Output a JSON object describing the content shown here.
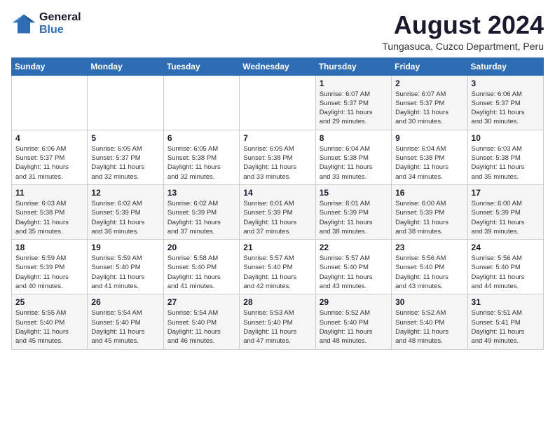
{
  "header": {
    "logo_line1": "General",
    "logo_line2": "Blue",
    "month_title": "August 2024",
    "location": "Tungasuca, Cuzco Department, Peru"
  },
  "weekdays": [
    "Sunday",
    "Monday",
    "Tuesday",
    "Wednesday",
    "Thursday",
    "Friday",
    "Saturday"
  ],
  "weeks": [
    [
      {
        "day": "",
        "info": ""
      },
      {
        "day": "",
        "info": ""
      },
      {
        "day": "",
        "info": ""
      },
      {
        "day": "",
        "info": ""
      },
      {
        "day": "1",
        "info": "Sunrise: 6:07 AM\nSunset: 5:37 PM\nDaylight: 11 hours\nand 29 minutes."
      },
      {
        "day": "2",
        "info": "Sunrise: 6:07 AM\nSunset: 5:37 PM\nDaylight: 11 hours\nand 30 minutes."
      },
      {
        "day": "3",
        "info": "Sunrise: 6:06 AM\nSunset: 5:37 PM\nDaylight: 11 hours\nand 30 minutes."
      }
    ],
    [
      {
        "day": "4",
        "info": "Sunrise: 6:06 AM\nSunset: 5:37 PM\nDaylight: 11 hours\nand 31 minutes."
      },
      {
        "day": "5",
        "info": "Sunrise: 6:05 AM\nSunset: 5:37 PM\nDaylight: 11 hours\nand 32 minutes."
      },
      {
        "day": "6",
        "info": "Sunrise: 6:05 AM\nSunset: 5:38 PM\nDaylight: 11 hours\nand 32 minutes."
      },
      {
        "day": "7",
        "info": "Sunrise: 6:05 AM\nSunset: 5:38 PM\nDaylight: 11 hours\nand 33 minutes."
      },
      {
        "day": "8",
        "info": "Sunrise: 6:04 AM\nSunset: 5:38 PM\nDaylight: 11 hours\nand 33 minutes."
      },
      {
        "day": "9",
        "info": "Sunrise: 6:04 AM\nSunset: 5:38 PM\nDaylight: 11 hours\nand 34 minutes."
      },
      {
        "day": "10",
        "info": "Sunrise: 6:03 AM\nSunset: 5:38 PM\nDaylight: 11 hours\nand 35 minutes."
      }
    ],
    [
      {
        "day": "11",
        "info": "Sunrise: 6:03 AM\nSunset: 5:38 PM\nDaylight: 11 hours\nand 35 minutes."
      },
      {
        "day": "12",
        "info": "Sunrise: 6:02 AM\nSunset: 5:39 PM\nDaylight: 11 hours\nand 36 minutes."
      },
      {
        "day": "13",
        "info": "Sunrise: 6:02 AM\nSunset: 5:39 PM\nDaylight: 11 hours\nand 37 minutes."
      },
      {
        "day": "14",
        "info": "Sunrise: 6:01 AM\nSunset: 5:39 PM\nDaylight: 11 hours\nand 37 minutes."
      },
      {
        "day": "15",
        "info": "Sunrise: 6:01 AM\nSunset: 5:39 PM\nDaylight: 11 hours\nand 38 minutes."
      },
      {
        "day": "16",
        "info": "Sunrise: 6:00 AM\nSunset: 5:39 PM\nDaylight: 11 hours\nand 38 minutes."
      },
      {
        "day": "17",
        "info": "Sunrise: 6:00 AM\nSunset: 5:39 PM\nDaylight: 11 hours\nand 39 minutes."
      }
    ],
    [
      {
        "day": "18",
        "info": "Sunrise: 5:59 AM\nSunset: 5:39 PM\nDaylight: 11 hours\nand 40 minutes."
      },
      {
        "day": "19",
        "info": "Sunrise: 5:59 AM\nSunset: 5:40 PM\nDaylight: 11 hours\nand 41 minutes."
      },
      {
        "day": "20",
        "info": "Sunrise: 5:58 AM\nSunset: 5:40 PM\nDaylight: 11 hours\nand 41 minutes."
      },
      {
        "day": "21",
        "info": "Sunrise: 5:57 AM\nSunset: 5:40 PM\nDaylight: 11 hours\nand 42 minutes."
      },
      {
        "day": "22",
        "info": "Sunrise: 5:57 AM\nSunset: 5:40 PM\nDaylight: 11 hours\nand 43 minutes."
      },
      {
        "day": "23",
        "info": "Sunrise: 5:56 AM\nSunset: 5:40 PM\nDaylight: 11 hours\nand 43 minutes."
      },
      {
        "day": "24",
        "info": "Sunrise: 5:56 AM\nSunset: 5:40 PM\nDaylight: 11 hours\nand 44 minutes."
      }
    ],
    [
      {
        "day": "25",
        "info": "Sunrise: 5:55 AM\nSunset: 5:40 PM\nDaylight: 11 hours\nand 45 minutes."
      },
      {
        "day": "26",
        "info": "Sunrise: 5:54 AM\nSunset: 5:40 PM\nDaylight: 11 hours\nand 45 minutes."
      },
      {
        "day": "27",
        "info": "Sunrise: 5:54 AM\nSunset: 5:40 PM\nDaylight: 11 hours\nand 46 minutes."
      },
      {
        "day": "28",
        "info": "Sunrise: 5:53 AM\nSunset: 5:40 PM\nDaylight: 11 hours\nand 47 minutes."
      },
      {
        "day": "29",
        "info": "Sunrise: 5:52 AM\nSunset: 5:40 PM\nDaylight: 11 hours\nand 48 minutes."
      },
      {
        "day": "30",
        "info": "Sunrise: 5:52 AM\nSunset: 5:40 PM\nDaylight: 11 hours\nand 48 minutes."
      },
      {
        "day": "31",
        "info": "Sunrise: 5:51 AM\nSunset: 5:41 PM\nDaylight: 11 hours\nand 49 minutes."
      }
    ]
  ]
}
